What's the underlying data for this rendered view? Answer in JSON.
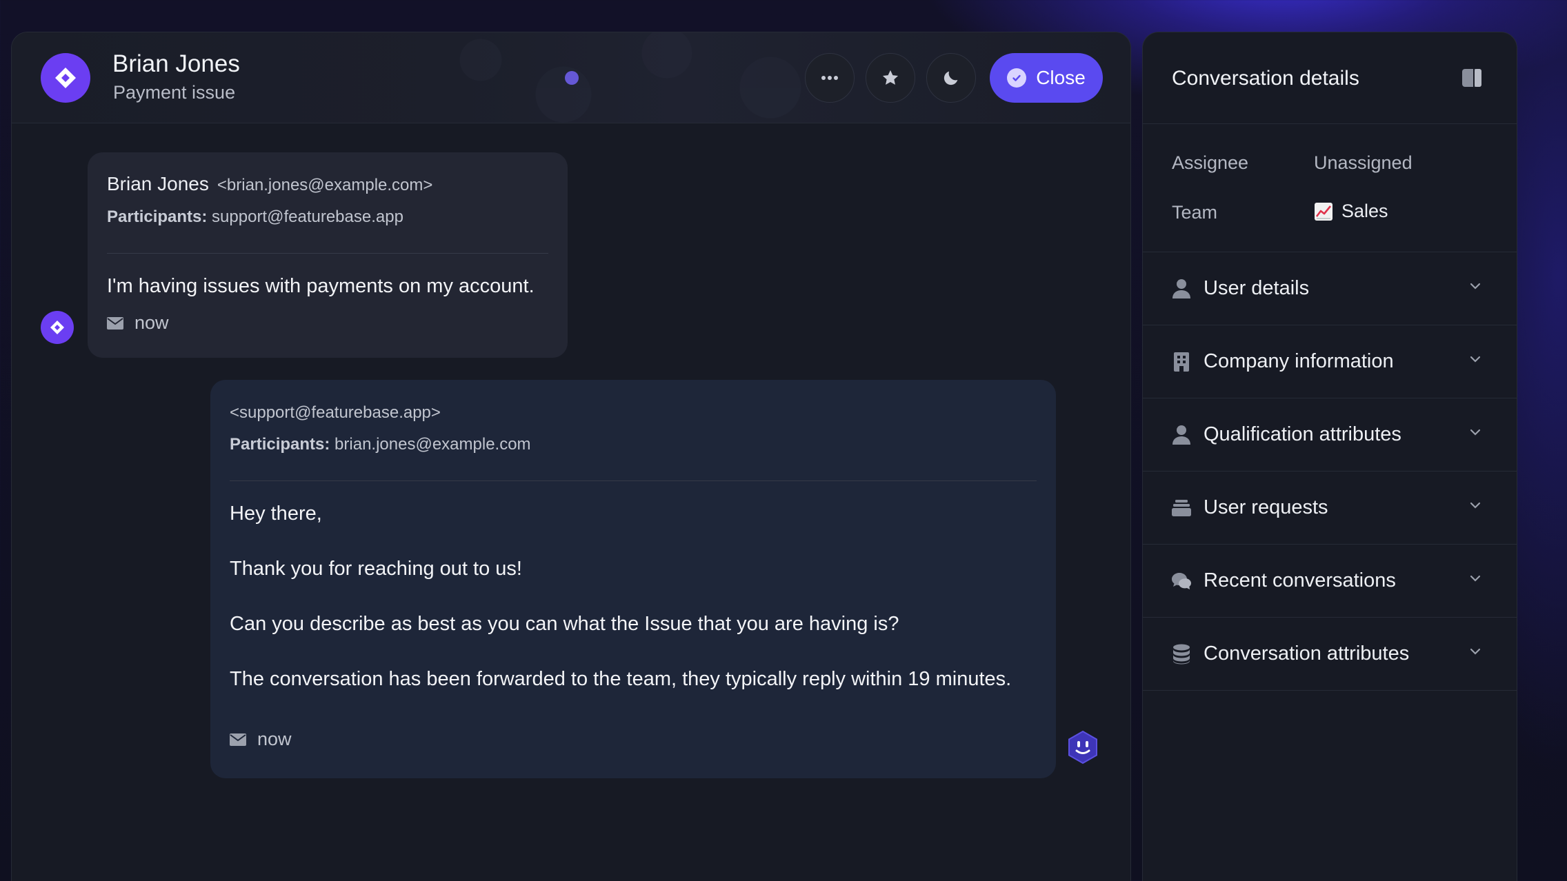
{
  "header": {
    "name": "Brian Jones",
    "subject": "Payment issue",
    "close_label": "Close"
  },
  "messages": [
    {
      "sender": "Brian Jones",
      "email": "<brian.jones@example.com>",
      "participants_label": "Participants:",
      "participants": "support@featurebase.app",
      "body": [
        "I'm having issues with payments on my account."
      ],
      "time": "now"
    },
    {
      "sender": "",
      "email": "<support@featurebase.app>",
      "participants_label": "Participants:",
      "participants": "brian.jones@example.com",
      "body": [
        "Hey there,",
        "Thank you for reaching out to us!",
        "Can you describe as best as you can what the Issue that you are having is?",
        "The conversation has been forwarded to the team, they typically reply within 19 minutes."
      ],
      "time": "now"
    }
  ],
  "sidebar": {
    "title": "Conversation details",
    "assignee_label": "Assignee",
    "assignee_value": "Unassigned",
    "team_label": "Team",
    "team_value": "Sales",
    "sections": [
      {
        "label": "User details",
        "icon": "user-icon"
      },
      {
        "label": "Company information",
        "icon": "building-icon"
      },
      {
        "label": "Qualification attributes",
        "icon": "user-icon"
      },
      {
        "label": "User requests",
        "icon": "inbox-icon"
      },
      {
        "label": "Recent conversations",
        "icon": "chat-bubbles-icon"
      },
      {
        "label": "Conversation attributes",
        "icon": "database-icon"
      }
    ]
  },
  "colors": {
    "accent": "#5a4af0",
    "brand": "#6b3ef2",
    "panel": "#171a24",
    "outgoing_bubble": "#1e2639",
    "incoming_bubble": "#232633"
  }
}
